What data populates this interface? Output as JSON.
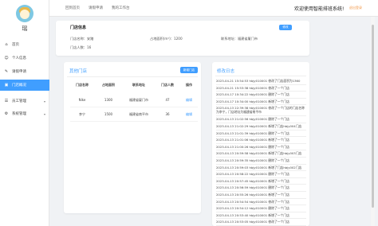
{
  "sidebar": {
    "username": "瑶",
    "items": [
      {
        "label": "首页",
        "icon": "home-icon",
        "glyph": "⌂",
        "active": false
      },
      {
        "label": "个人信息",
        "icon": "user-icon",
        "glyph": "☺",
        "active": false
      },
      {
        "label": "请假申请",
        "icon": "leave-icon",
        "glyph": "✎",
        "active": false
      },
      {
        "label": "门店概况",
        "icon": "store-icon",
        "glyph": "▣",
        "active": true
      },
      {
        "label": "员工管理",
        "icon": "staff-icon",
        "glyph": "☰",
        "active": false
      },
      {
        "label": "系统管理",
        "icon": "system-icon",
        "glyph": "⚙",
        "active": false
      }
    ]
  },
  "topbar": {
    "nav": [
      "回到首页",
      "请假申请",
      "我的工作台"
    ],
    "welcome": "欢迎使用智能排班系统!",
    "logout": "退出登录"
  },
  "store_info": {
    "title": "门店信息",
    "name_label": "门店名称：安踏",
    "area_label": "占地面积(m²)：1200",
    "address_label": "联系地址：福建省厦门市",
    "count_label": "门店人数：16",
    "edit_button": "修改"
  },
  "other_stores": {
    "title": "其他门店",
    "add_button": "新增门店",
    "columns": [
      "门店名称",
      "占地面积",
      "联系地址",
      "门店人数",
      "操作"
    ],
    "rows": [
      {
        "name": "Nike",
        "area": "1300",
        "address": "福建省厦门市",
        "count": "47",
        "op": "编辑"
      },
      {
        "name": "李宁",
        "area": "1500",
        "address": "福建省南平市",
        "count": "36",
        "op": "编辑"
      }
    ]
  },
  "logs": {
    "title": "修改日志",
    "entries": [
      "2023-04-21 15:54:53 hbjy010001 修改了门店面积为1360",
      "2023-04-21 15:53:38 hbjy010001 修改了一个门店",
      "2023-04-17 10:34:22 hbjy010001 删除了一个门店",
      "2023-04-17 10:34:00 hbjy010001 新增了一个门店",
      "2023-04-13 22:39:38 hbjy010001 修改了一个门店的门店名称为李宁，门店地址为福建省南平市",
      "2023-04-13 21:02:56 hbjy010001 删除了一个门店",
      "2023-04-13 21:02:29 hbjy010001 新增了门店hbjy004门店",
      "2023-04-13 21:01:39 hbjy010001 删除了一个门店",
      "2023-04-13 21:01:06 hbjy010001 新增了一个门店",
      "2023-04-13 21:00:26 hbjy010001 删除了一个门店",
      "2023-04-13 20:59:58 hbjy010001 新增了门店hbjy003门店",
      "2023-04-13 20:59:35 hbjy010001 删除了一个门店",
      "2023-04-13 20:59:03 hbjy010001 新增了门店hbjy002门店",
      "2023-04-13 20:58:22 hbjy010001 删除了一个门店",
      "2023-04-13 20:57:45 hbjy010001 新增了一个门店",
      "2023-04-13 20:56:59 hbjy010001 删除了一个门店",
      "2023-04-13 20:55:26 hbjy010001 新增了一个门店",
      "2023-04-13 20:54:54 hbjy010001 修改了一个门店",
      "2023-04-13 20:54:12 hbjy010001 删除了一个门店",
      "2023-04-13 20:53:40 hbjy010001 新增了一个门店",
      "2023-04-13 20:53:05 hbjy010001 修改了一个门店"
    ]
  }
}
